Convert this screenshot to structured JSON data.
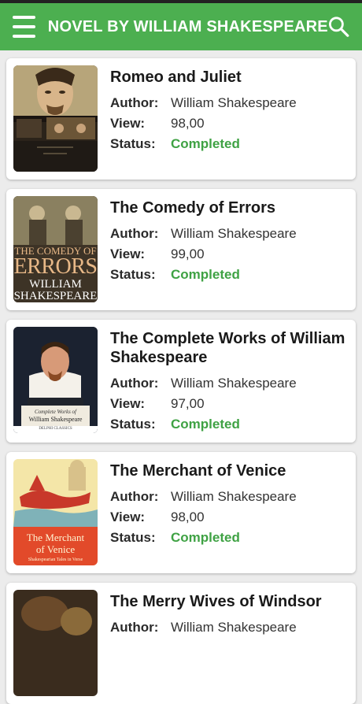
{
  "header": {
    "title": "NOVEL BY WILLIAM SHAKESPEARE"
  },
  "labels": {
    "author": "Author:",
    "view": "View:",
    "status": "Status:"
  },
  "colors": {
    "accent": "#4caf50",
    "status_completed": "#3fa244"
  },
  "novels": [
    {
      "title": "Romeo and Juliet",
      "author": "William Shakespeare",
      "view": "98,00",
      "status": "Completed"
    },
    {
      "title": "The Comedy of Errors",
      "author": "William Shakespeare",
      "view": "99,00",
      "status": "Completed",
      "cover_text": [
        "THE COMEDY OF",
        "ERRORS",
        "WILLIAM",
        "SHAKESPEARE"
      ]
    },
    {
      "title": "The Complete Works of William Shakespeare",
      "author": "William Shakespeare",
      "view": "97,00",
      "status": "Completed",
      "cover_text": [
        "Complete Works of",
        "William Shakespeare",
        "DELPHI CLASSICS"
      ]
    },
    {
      "title": "The Merchant of Venice",
      "author": "William Shakespeare",
      "view": "98,00",
      "status": "Completed",
      "cover_text": [
        "The Merchant",
        "of Venice",
        "Shakespearian Tales in Verse"
      ]
    },
    {
      "title": "The Merry Wives of Windsor",
      "author": "William Shakespeare"
    }
  ]
}
